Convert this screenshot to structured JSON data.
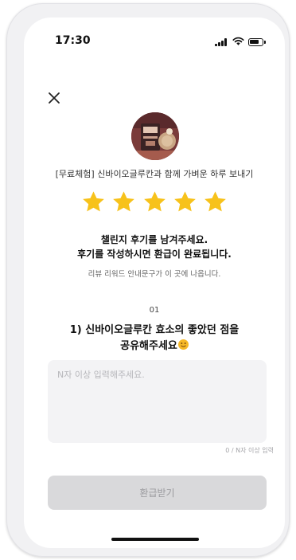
{
  "status_bar": {
    "time": "17:30",
    "signal_icon": "cellular-signal-icon",
    "wifi_icon": "wifi-icon",
    "battery_icon": "battery-icon"
  },
  "header": {
    "close_icon": "close-icon"
  },
  "product": {
    "thumbnail_icon": "product-thumbnail",
    "title": "[무료체험] 신바이오글루칸과 함께 가벼운 하루 보내기"
  },
  "rating": {
    "value": 5,
    "max": 5,
    "color": "#f7c21b"
  },
  "messages": {
    "line1": "챌린지 후기를 남겨주세요.",
    "line2": "후기를 작성하시면 환급이 완료됩니다.",
    "notice": "리뷰 리워드 안내문구가 이 곳에 나옵니다."
  },
  "question": {
    "number": "01",
    "line1": "1) 신바이오글루칸 효소의 좋았던 점을",
    "line2": "공유해주세요",
    "emoji_icon": "smiling-face-emoji"
  },
  "review": {
    "placeholder": "N자 이상 입력해주세요.",
    "value": "",
    "char_count": "0 / N자 이상 입력"
  },
  "submit": {
    "label": "환급받기",
    "disabled": true
  },
  "colors": {
    "star": "#f7c21b",
    "button_bg": "#d9d9db",
    "button_text": "#9a9a9e",
    "input_bg": "#f3f3f5",
    "product_bg": "#7a3b3a"
  }
}
